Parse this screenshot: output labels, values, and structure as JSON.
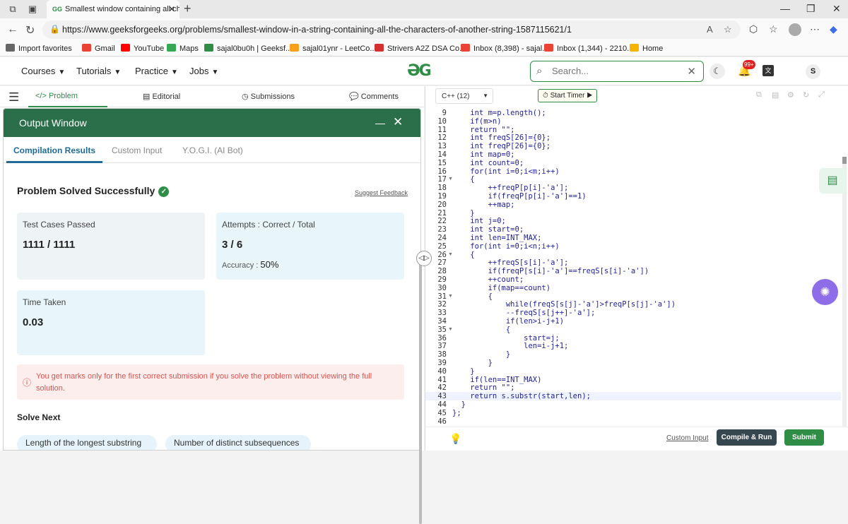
{
  "browser": {
    "tab_title": "Smallest window containing all ch",
    "url": "https://www.geeksforgeeks.org/problems/smallest-window-in-a-string-containing-all-the-characters-of-another-string-1587115621/1",
    "bookmarks": [
      {
        "label": "Import favorites",
        "color": "#444444"
      },
      {
        "label": "Gmail",
        "color": "#ea4335"
      },
      {
        "label": "YouTube",
        "color": "#ff0000"
      },
      {
        "label": "Maps",
        "color": "#34a853"
      },
      {
        "label": "sajal0bu0h | Geeksf...",
        "color": "#2f8d46"
      },
      {
        "label": "sajal01ynr - LeetCo...",
        "color": "#f89f1b"
      },
      {
        "label": "Strivers A2Z DSA Co...",
        "color": "#d32f2f"
      },
      {
        "label": "Inbox (8,398) - sajal...",
        "color": "#ea4335"
      },
      {
        "label": "Inbox (1,344) - 2210...",
        "color": "#ea4335"
      },
      {
        "label": "Home",
        "color": "#f5b400"
      }
    ]
  },
  "header": {
    "menus": [
      "Courses",
      "Tutorials",
      "Practice",
      "Jobs"
    ],
    "search_placeholder": "Search...",
    "notification_count": "99+",
    "user_initial": "S",
    "brand_color": "#2f8d46"
  },
  "problem_tabs": {
    "problem": "Problem",
    "editorial": "Editorial",
    "submissions": "Submissions",
    "comments": "Comments"
  },
  "output": {
    "title": "Output Window",
    "tabs": [
      "Compilation Results",
      "Custom Input",
      "Y.O.G.I. (AI Bot)"
    ],
    "status": "Problem Solved Successfully",
    "feedback_link": "Suggest Feedback",
    "test_cases_label": "Test Cases Passed",
    "test_cases_value": "1111 / 1111",
    "attempts_label": "Attempts : Correct / Total",
    "attempts_value": "3 / 6",
    "accuracy_label": "Accuracy :",
    "accuracy_value": "50%",
    "time_label": "Time Taken",
    "time_value": "0.03",
    "warning": "You get marks only for the first correct submission if you solve the problem without viewing the full solution.",
    "solve_next_title": "Solve Next",
    "solve_next_items": [
      "Length of the longest substring",
      "Number of distinct subsequences"
    ]
  },
  "editor": {
    "language": "C++ (12)",
    "timer_label": "Start Timer",
    "lines": [
      {
        "n": "9",
        "fold": false,
        "text": "    int m=p.length();"
      },
      {
        "n": "10",
        "fold": false,
        "text": "    if(m>n)"
      },
      {
        "n": "11",
        "fold": false,
        "text": "    return \"\";"
      },
      {
        "n": "12",
        "fold": false,
        "text": "    int freqS[26]={0};"
      },
      {
        "n": "13",
        "fold": false,
        "text": "    int freqP[26]={0};"
      },
      {
        "n": "14",
        "fold": false,
        "text": "    int map=0;"
      },
      {
        "n": "15",
        "fold": false,
        "text": "    int count=0;"
      },
      {
        "n": "16",
        "fold": false,
        "text": "    for(int i=0;i<m;i++)"
      },
      {
        "n": "17",
        "fold": true,
        "text": "    {"
      },
      {
        "n": "18",
        "fold": false,
        "text": "        ++freqP[p[i]-'a'];"
      },
      {
        "n": "19",
        "fold": false,
        "text": "        if(freqP[p[i]-'a']==1)"
      },
      {
        "n": "20",
        "fold": false,
        "text": "        ++map;"
      },
      {
        "n": "21",
        "fold": false,
        "text": "    }"
      },
      {
        "n": "22",
        "fold": false,
        "text": "    int j=0;"
      },
      {
        "n": "23",
        "fold": false,
        "text": "    int start=0;"
      },
      {
        "n": "24",
        "fold": false,
        "text": "    int len=INT_MAX;"
      },
      {
        "n": "25",
        "fold": false,
        "text": "    for(int i=0;i<n;i++)"
      },
      {
        "n": "26",
        "fold": true,
        "text": "    {"
      },
      {
        "n": "27",
        "fold": false,
        "text": "        ++freqS[s[i]-'a'];"
      },
      {
        "n": "28",
        "fold": false,
        "text": "        if(freqP[s[i]-'a']==freqS[s[i]-'a'])"
      },
      {
        "n": "29",
        "fold": false,
        "text": "        ++count;"
      },
      {
        "n": "30",
        "fold": false,
        "text": "        if(map==count)"
      },
      {
        "n": "31",
        "fold": true,
        "text": "        {"
      },
      {
        "n": "32",
        "fold": false,
        "text": "            while(freqS[s[j]-'a']>freqP[s[j]-'a'])"
      },
      {
        "n": "33",
        "fold": false,
        "text": "            --freqS[s[j++]-'a'];"
      },
      {
        "n": "34",
        "fold": false,
        "text": "            if(len>i-j+1)"
      },
      {
        "n": "35",
        "fold": true,
        "text": "            {"
      },
      {
        "n": "36",
        "fold": false,
        "text": "                start=j;"
      },
      {
        "n": "37",
        "fold": false,
        "text": "                len=i-j+1;"
      },
      {
        "n": "38",
        "fold": false,
        "text": "            }"
      },
      {
        "n": "39",
        "fold": false,
        "text": "        }"
      },
      {
        "n": "40",
        "fold": false,
        "text": "    }"
      },
      {
        "n": "41",
        "fold": false,
        "text": "    if(len==INT_MAX)"
      },
      {
        "n": "42",
        "fold": false,
        "text": "    return \"\";"
      },
      {
        "n": "43",
        "fold": false,
        "text": "    return s.substr(start,len);"
      },
      {
        "n": "44",
        "fold": false,
        "text": "  }"
      },
      {
        "n": "45",
        "fold": false,
        "text": "};"
      },
      {
        "n": "46",
        "fold": false,
        "text": ""
      }
    ],
    "current_line": "43",
    "custom_input_label": "Custom Input",
    "compile_label": "Compile & Run",
    "submit_label": "Submit"
  }
}
